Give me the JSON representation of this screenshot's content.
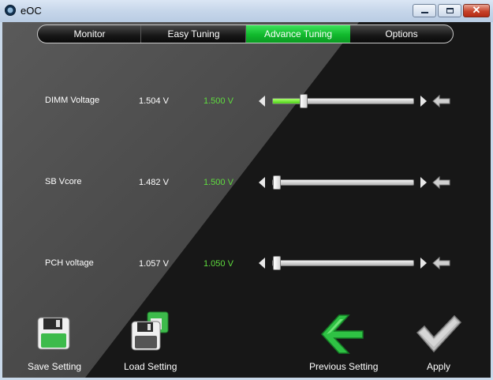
{
  "window": {
    "title": "eOC",
    "icon": "eoc-app-icon",
    "controls": {
      "minimize": "minimize-icon",
      "maximize": "maximize-icon",
      "close": "✕"
    }
  },
  "tabs": [
    {
      "label": "Monitor",
      "active": false
    },
    {
      "label": "Easy Tuning",
      "active": false
    },
    {
      "label": "Advance Tuning",
      "active": true
    },
    {
      "label": "Options",
      "active": false
    }
  ],
  "settings": [
    {
      "label": "DIMM Voltage",
      "current": "1.504 V",
      "target": "1.500 V",
      "level": 0.2
    },
    {
      "label": "SB Vcore",
      "current": "1.482 V",
      "target": "1.500 V",
      "level": 0.0
    },
    {
      "label": "PCH voltage",
      "current": "1.057 V",
      "target": "1.050 V",
      "level": 0.0
    }
  ],
  "actions": {
    "save": {
      "label": "Save Setting",
      "icon": "floppy-disk-icon"
    },
    "load": {
      "label": "Load Setting",
      "icon": "load-floppy-icon"
    },
    "previous": {
      "label": "Previous Setting",
      "icon": "green-back-arrow-icon"
    },
    "apply": {
      "label": "Apply",
      "icon": "checkmark-icon"
    }
  },
  "colors": {
    "accent_green": "#11b92d",
    "value_green": "#5fdc3e",
    "background": "#1c1c1c"
  }
}
